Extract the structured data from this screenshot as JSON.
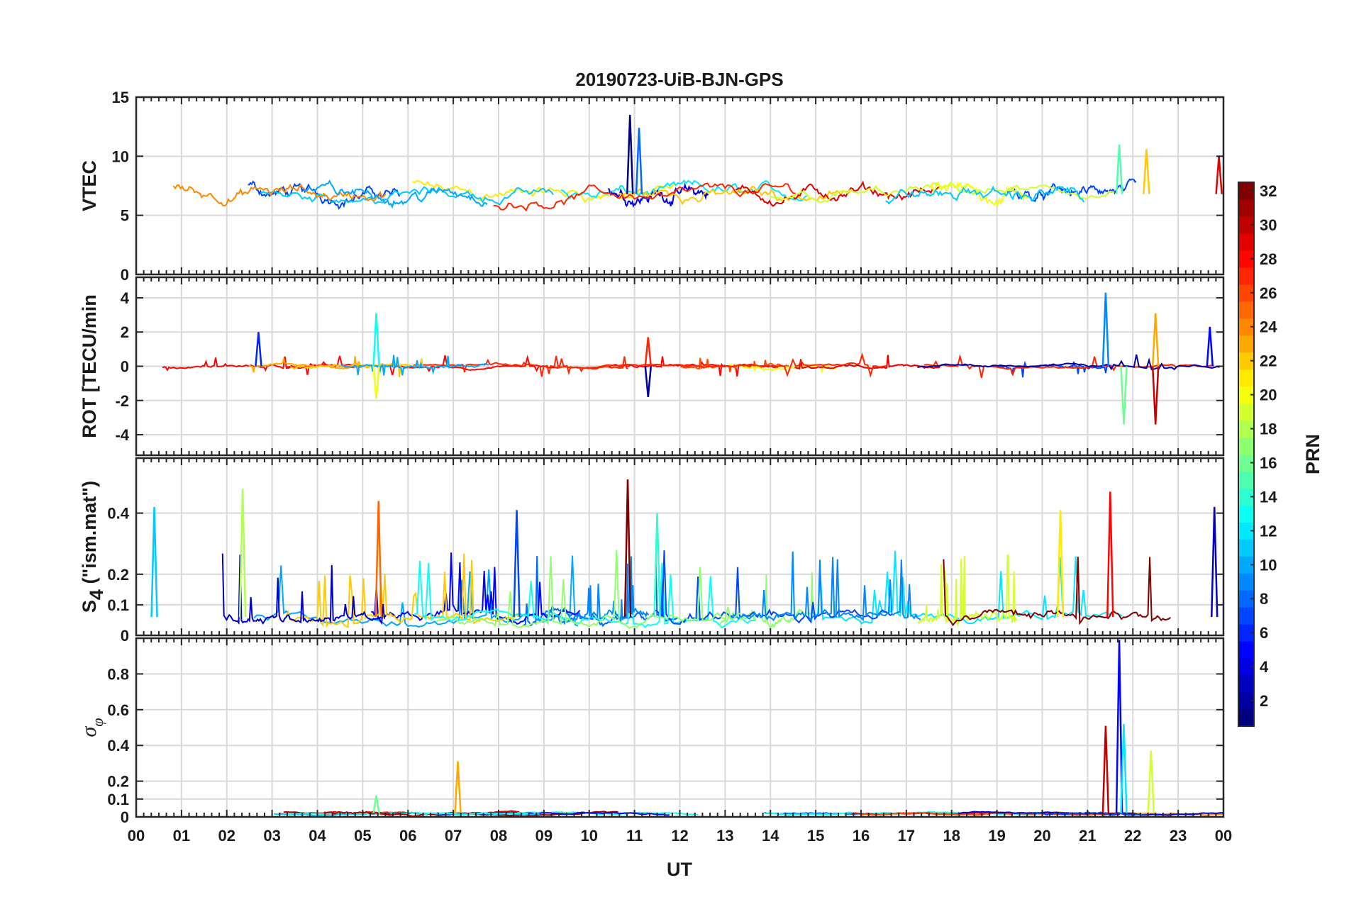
{
  "chart_data": {
    "type": "line",
    "title": "20190723-UiB-BJN-GPS",
    "xlabel": "UT",
    "x_ticks": [
      "00",
      "01",
      "02",
      "03",
      "04",
      "05",
      "06",
      "07",
      "08",
      "09",
      "10",
      "11",
      "12",
      "13",
      "14",
      "15",
      "16",
      "17",
      "18",
      "19",
      "20",
      "21",
      "22",
      "23",
      "00"
    ],
    "xlim_hours": [
      0,
      24
    ],
    "grid": true,
    "colorbar": {
      "label": "PRN",
      "range": [
        1,
        32
      ],
      "ticks": [
        "2",
        "4",
        "6",
        "8",
        "10",
        "12",
        "14",
        "16",
        "18",
        "20",
        "22",
        "24",
        "26",
        "28",
        "30",
        "32"
      ],
      "colormap": "jet",
      "colors": [
        "#00008f",
        "#0000ff",
        "#007fff",
        "#00ffff",
        "#7fff7f",
        "#ffff00",
        "#ff7f00",
        "#ff0000",
        "#7f0000"
      ]
    },
    "panels": [
      {
        "id": "vtec",
        "ylabel": "VTEC",
        "ylim": [
          0,
          15
        ],
        "yticks": [
          0,
          5,
          10,
          15
        ],
        "ytick_labels": [
          "0",
          "5",
          "10",
          "15"
        ],
        "baseline": 6.8,
        "spread": 1.0,
        "spikes": [
          {
            "hour": 10.9,
            "value": 13.5
          },
          {
            "hour": 11.1,
            "value": 12.4
          },
          {
            "hour": 21.7,
            "value": 11.0
          },
          {
            "hour": 22.3,
            "value": 10.6
          },
          {
            "hour": 23.9,
            "value": 10.0
          }
        ]
      },
      {
        "id": "rot",
        "ylabel": "ROT [TECU/min",
        "ylim": [
          -5.2,
          5.2
        ],
        "yticks": [
          -4,
          -2,
          0,
          2,
          4
        ],
        "ytick_labels": [
          "-4",
          "-2",
          "0",
          "2",
          "4"
        ],
        "baseline": 0,
        "spread": 0.15,
        "spikes": [
          {
            "hour": 2.7,
            "value": 2.0
          },
          {
            "hour": 5.3,
            "value": 3.1
          },
          {
            "hour": 5.3,
            "value": -1.9
          },
          {
            "hour": 11.3,
            "value": 1.7
          },
          {
            "hour": 11.3,
            "value": -1.8
          },
          {
            "hour": 21.4,
            "value": 4.3
          },
          {
            "hour": 21.8,
            "value": -3.4
          },
          {
            "hour": 22.5,
            "value": 3.1
          },
          {
            "hour": 22.5,
            "value": -3.4
          },
          {
            "hour": 23.7,
            "value": 2.3
          }
        ]
      },
      {
        "id": "s4",
        "ylabel_main": "S",
        "ylabel_sub": "4",
        "ylabel_rest": " (\"ism.mat\")",
        "ylim": [
          0,
          0.58
        ],
        "yticks": [
          0,
          0.1,
          0.2,
          0.4
        ],
        "ytick_labels": [
          "0",
          "0.1",
          "0.2",
          "0.4"
        ],
        "baseline": 0.06,
        "spread": 0.03,
        "spikes": [
          {
            "hour": 0.4,
            "value": 0.42
          },
          {
            "hour": 2.35,
            "value": 0.48
          },
          {
            "hour": 5.35,
            "value": 0.44
          },
          {
            "hour": 10.85,
            "value": 0.51
          },
          {
            "hour": 8.4,
            "value": 0.41
          },
          {
            "hour": 11.5,
            "value": 0.4
          },
          {
            "hour": 20.4,
            "value": 0.41
          },
          {
            "hour": 21.5,
            "value": 0.47
          },
          {
            "hour": 23.8,
            "value": 0.42
          }
        ]
      },
      {
        "id": "sigphi",
        "ylabel_main": "σ",
        "ylabel_sub": "φ",
        "ylim": [
          0,
          1.0
        ],
        "yticks": [
          0,
          0.1,
          0.2,
          0.4,
          0.6,
          0.8
        ],
        "ytick_labels": [
          "0",
          "0.1",
          "0.2",
          "0.4",
          "0.6",
          "0.8"
        ],
        "baseline": 0.02,
        "spread": 0.01,
        "spikes": [
          {
            "hour": 5.3,
            "value": 0.12
          },
          {
            "hour": 7.1,
            "value": 0.31
          },
          {
            "hour": 21.4,
            "value": 0.51
          },
          {
            "hour": 21.7,
            "value": 0.99
          },
          {
            "hour": 21.8,
            "value": 0.52
          },
          {
            "hour": 22.4,
            "value": 0.37
          }
        ]
      }
    ]
  }
}
